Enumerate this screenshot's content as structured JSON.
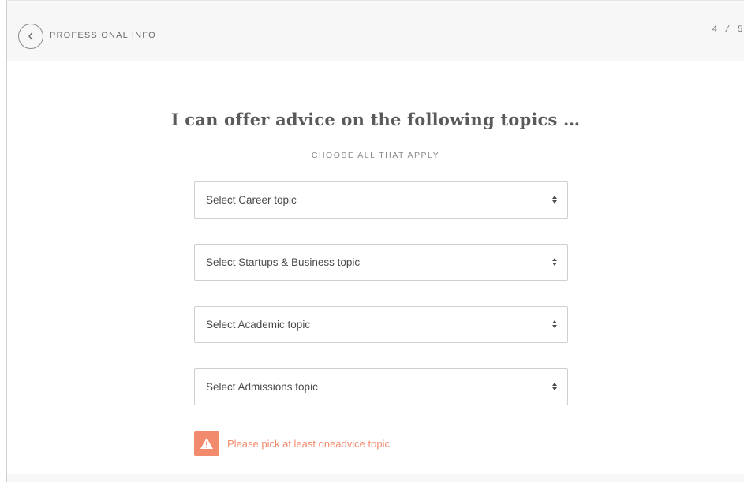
{
  "header": {
    "back_icon": "chevron-left-icon",
    "title": "PROFESSIONAL INFO",
    "step": "4 / 5"
  },
  "main": {
    "heading": "I can offer advice on the following topics …",
    "subheading": "CHOOSE ALL THAT APPLY",
    "selects": [
      {
        "label": "Select Career topic",
        "icon": "sort-arrows-icon"
      },
      {
        "label": "Select Startups & Business topic",
        "icon": "sort-arrows-icon"
      },
      {
        "label": "Select Academic topic",
        "icon": "sort-arrows-icon"
      },
      {
        "label": "Select Admissions topic",
        "icon": "sort-arrows-icon"
      }
    ],
    "warning": {
      "icon": "warning-icon",
      "text": "Please pick at least oneadvice topic",
      "color": "#f28b6e"
    }
  }
}
